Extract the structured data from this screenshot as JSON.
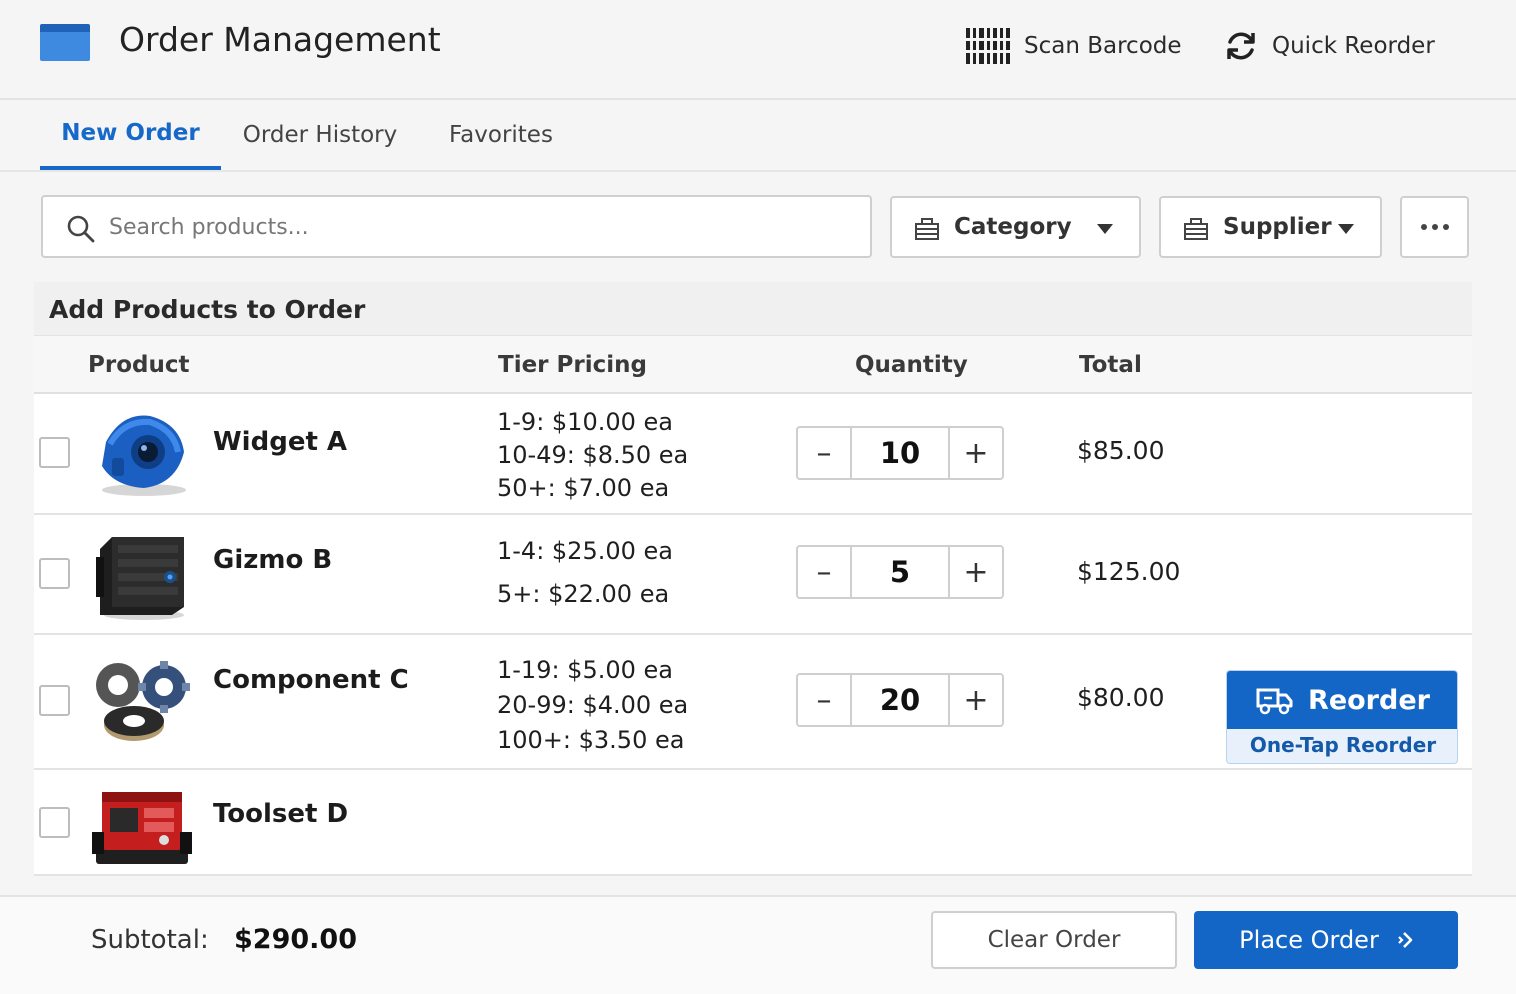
{
  "header": {
    "title": "Order Management",
    "scan_label": "Scan Barcode",
    "quick_reorder_label": "Quick Reorder"
  },
  "tabs": [
    {
      "label": "New Order",
      "active": true
    },
    {
      "label": "Order History",
      "active": false
    },
    {
      "label": "Favorites",
      "active": false
    }
  ],
  "toolbar": {
    "search_placeholder": "Search products...",
    "search_value": "",
    "category_label": "Category",
    "supplier_label": "Supplier"
  },
  "panel": {
    "title": "Add Products to Order",
    "columns": {
      "product": "Product",
      "tier_pricing": "Tier Pricing",
      "quantity": "Quantity",
      "total": "Total"
    }
  },
  "products": [
    {
      "name": "Widget A",
      "tiers": [
        "1-9: $10.00 ea",
        "10-49: $8.50 ea",
        "50+: $7.00 ea"
      ],
      "quantity": "10",
      "total": "$85.00",
      "checked": false
    },
    {
      "name": "Gizmo B",
      "tiers": [
        "1-4: $25.00 ea",
        "5+: $22.00 ea"
      ],
      "quantity": "5",
      "total": "$125.00",
      "checked": false
    },
    {
      "name": "Component C",
      "tiers": [
        "1-19: $5.00 ea",
        "20-99: $4.00 ea",
        "100+: $3.50 ea"
      ],
      "quantity": "20",
      "total": "$80.00",
      "checked": false,
      "reorder": {
        "button_label": "Reorder",
        "sub_label": "One-Tap Reorder"
      }
    },
    {
      "name": "Toolset D",
      "checked": false
    }
  ],
  "stepper_symbols": {
    "minus": "–",
    "plus": "+"
  },
  "footer": {
    "subtotal_label": "Subtotal:",
    "subtotal_value": "$290.00",
    "clear_label": "Clear Order",
    "place_label": "Place Order"
  },
  "colors": {
    "accent": "#1466c6",
    "tab_active": "#1769c9",
    "logo": "#3d8ae0"
  },
  "icons": [
    "app-logo",
    "barcode-icon",
    "refresh-icon",
    "search-icon",
    "filter-icon",
    "caret-down-icon",
    "more-icon",
    "truck-icon",
    "arrow-right-icon"
  ]
}
